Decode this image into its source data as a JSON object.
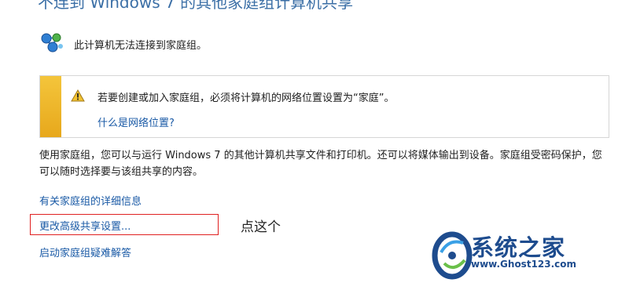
{
  "header": {
    "partial_title": "不连到 Windows 7 的其他家庭组计算机共享"
  },
  "status": {
    "icon": "homegroup-network-icon",
    "text": "此计算机无法连接到家庭组。"
  },
  "warning": {
    "icon": "warning-triangle-icon",
    "accent_color": "#f0b52e",
    "message": "若要创建或加入家庭组，必须将计算机的网络位置设置为“家庭”。",
    "link_label": "什么是网络位置?"
  },
  "description": "使用家庭组，您可以与运行 Windows 7 的其他计算机共享文件和打印机。还可以将媒体输出到设备。家庭组受密码保护，您可以随时选择要与该组共享的内容。",
  "links": {
    "details": "有关家庭组的详细信息",
    "advanced_sharing": "更改高级共享设置...",
    "troubleshoot": "启动家庭组疑难解答"
  },
  "annotation": {
    "text": "点这个",
    "highlight_color": "#e02020"
  },
  "watermark": {
    "title": "系统之家",
    "url": "www.Ghost123.com"
  },
  "colors": {
    "link": "#1a5aa6",
    "text": "#1e1e1e"
  }
}
